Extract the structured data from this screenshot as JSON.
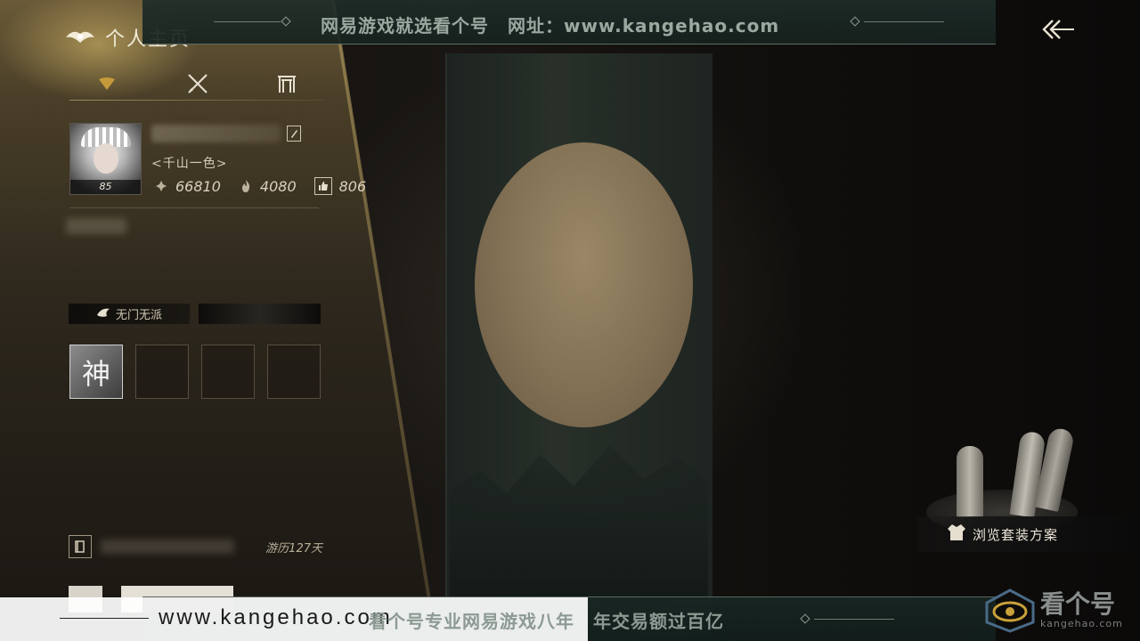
{
  "header": {
    "title": "个人主页"
  },
  "tabs": [
    {
      "name": "profile",
      "icon": "leaf-fan-icon",
      "active": true
    },
    {
      "name": "combat",
      "icon": "crossed-swords-icon",
      "active": false
    },
    {
      "name": "residence",
      "icon": "gate-icon",
      "active": false
    }
  ],
  "profile": {
    "level": "85",
    "guild": "<千山一色>",
    "stats": {
      "score": "66810",
      "heat": "4080",
      "likes": "806"
    }
  },
  "sect": {
    "label": "无门无派"
  },
  "slots": [
    {
      "glyph": "神",
      "filled": true
    },
    {
      "glyph": "",
      "filled": false
    },
    {
      "glyph": "",
      "filled": false
    },
    {
      "glyph": "",
      "filled": false
    }
  ],
  "journey": {
    "days_label": "游历127天"
  },
  "outfit_button": {
    "label": "浏览套装方案"
  },
  "watermark": {
    "top_text": "网易游戏就选看个号　网址：www.kangehao.com",
    "bottom_url": "www.kangehao.com",
    "bottom_text": "看个号专业网易游戏八年　年交易额过百亿",
    "logo_cn": "看个号",
    "logo_en": "kangehao.com"
  },
  "colors": {
    "panel_gold": "#6a5a38",
    "text_light": "#d8d0c0",
    "watermark_teal": "#1e2c28"
  }
}
